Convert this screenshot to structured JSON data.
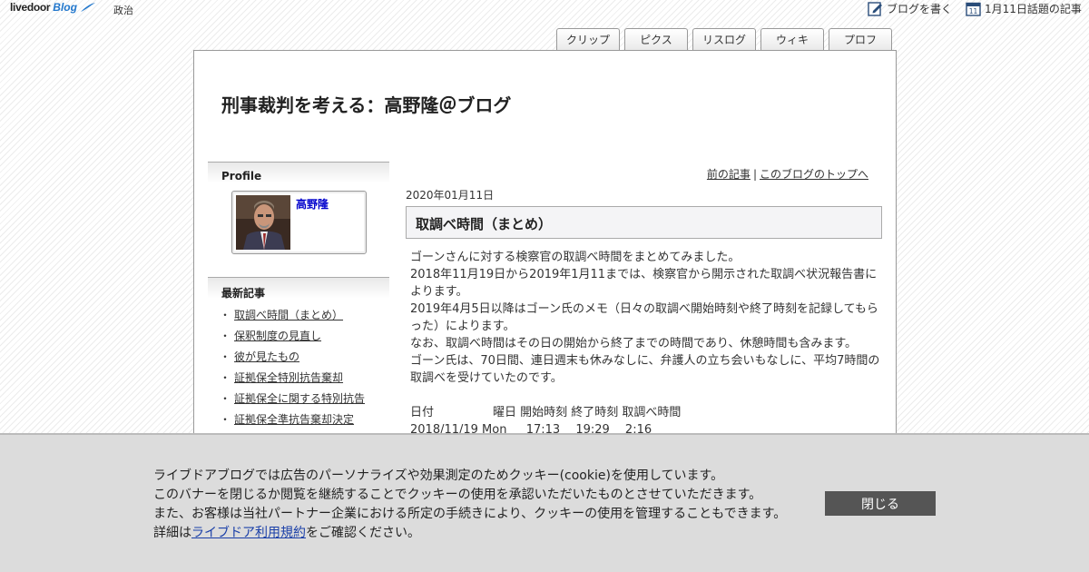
{
  "header": {
    "logo_text": "livedoor",
    "logo_sub": "Blog",
    "category": "政治",
    "write_link": "ブログを書く",
    "topic_link": "1月11日話題の記事",
    "calendar_day": "11"
  },
  "tabs": [
    "クリップ",
    "ピクス",
    "リスログ",
    "ウィキ",
    "プロフ"
  ],
  "blog": {
    "title": "刑事裁判を考える：高野隆＠ブログ"
  },
  "sidebar": {
    "profile_heading": "Profile",
    "profile_name": "高野隆",
    "recent_heading": "最新記事",
    "recent": [
      "取調べ時間（まとめ）",
      "保釈制度の見直し",
      "彼が見たもの",
      "証拠保全特別抗告棄却",
      "証拠保全に関する特別抗告",
      "証拠保全準抗告棄却決定"
    ]
  },
  "article": {
    "prev_link": "前の記事",
    "top_link": "このブログのトップへ",
    "separator": "|",
    "date": "2020年01月11日",
    "title": "取調べ時間（まとめ）",
    "paragraphs": [
      "ゴーンさんに対する検察官の取調べ時間をまとめてみました。",
      "2018年11月19日から2019年1月11までは、検察官から開示された取調べ状況報告書によります。",
      "2019年4月5日以降はゴーン氏のメモ（日々の取調べ開始時刻や終了時刻を記録してもらった）によります。",
      "なお、取調べ時間はその日の開始から終了までの時間であり、休憩時間も含みます。",
      "ゴーン氏は、70日間、連日週末も休みなしに、弁護人の立ち会いもなしに、平均7時間の取調べを受けていたのです。"
    ],
    "table_header": "日付　　　　　曜日 開始時刻 終了時刻 取調べ時間",
    "table_row": "2018/11/19 Mon　  17:13　 19:29　 2:16"
  },
  "cookie": {
    "line1": "ライブドアブログでは広告のパーソナライズや効果測定のためクッキー(cookie)を使用しています。",
    "line2": "このバナーを閉じるか閲覧を継続することでクッキーの使用を承認いただいたものとさせていただきます。",
    "line3": "また、お客様は当社パートナー企業における所定の手続きにより、クッキーの使用を管理することもできます。",
    "line4_pre": "詳細は",
    "line4_link": "ライブドア利用規約",
    "line4_post": "をご確認ください。",
    "close_label": "閉じる"
  }
}
